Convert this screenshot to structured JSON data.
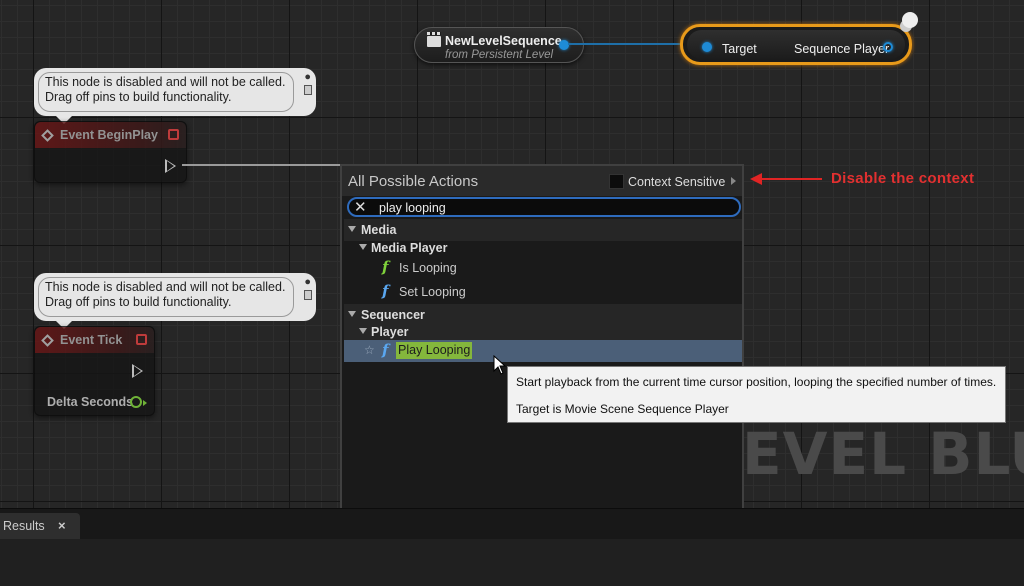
{
  "graph": {
    "watermark": "EVEL BLUEP"
  },
  "comments": [
    {
      "line1": "This node is disabled and will not be called.",
      "line2": "Drag off pins to build functionality."
    },
    {
      "line1": "This node is disabled and will not be called.",
      "line2": "Drag off pins to build functionality."
    }
  ],
  "event_begin_play": {
    "title": "Event BeginPlay"
  },
  "event_tick": {
    "title": "Event Tick",
    "output_label": "Delta Seconds"
  },
  "sequence_node": {
    "title": "NewLevelSequence",
    "subtitle": "from Persistent Level"
  },
  "target_node": {
    "target_label": "Target",
    "output_label": "Sequence Player"
  },
  "menu": {
    "title": "All Possible Actions",
    "context_label": "Context Sensitive",
    "search_value": "play looping",
    "categories": [
      {
        "label": "Media",
        "subcategory": "Media Player",
        "items": [
          "Is Looping",
          "Set Looping"
        ]
      },
      {
        "label": "Sequencer",
        "subcategory": "Player",
        "items": [
          "Play Looping"
        ]
      }
    ]
  },
  "tooltip": {
    "description": "Start playback from the current time cursor position, looping the specified number of times.",
    "target": "Target is Movie Scene Sequence Player"
  },
  "annotation": {
    "text": "Disable the context",
    "color": "#e23030"
  },
  "bottom_panel": {
    "tab_label": "Results",
    "close_glyph": "×"
  },
  "colors": {
    "accent_orange": "#e89a1a",
    "selection": "#4b5f78",
    "search_border": "#2e6bbd",
    "highlight": "#84b73c"
  }
}
